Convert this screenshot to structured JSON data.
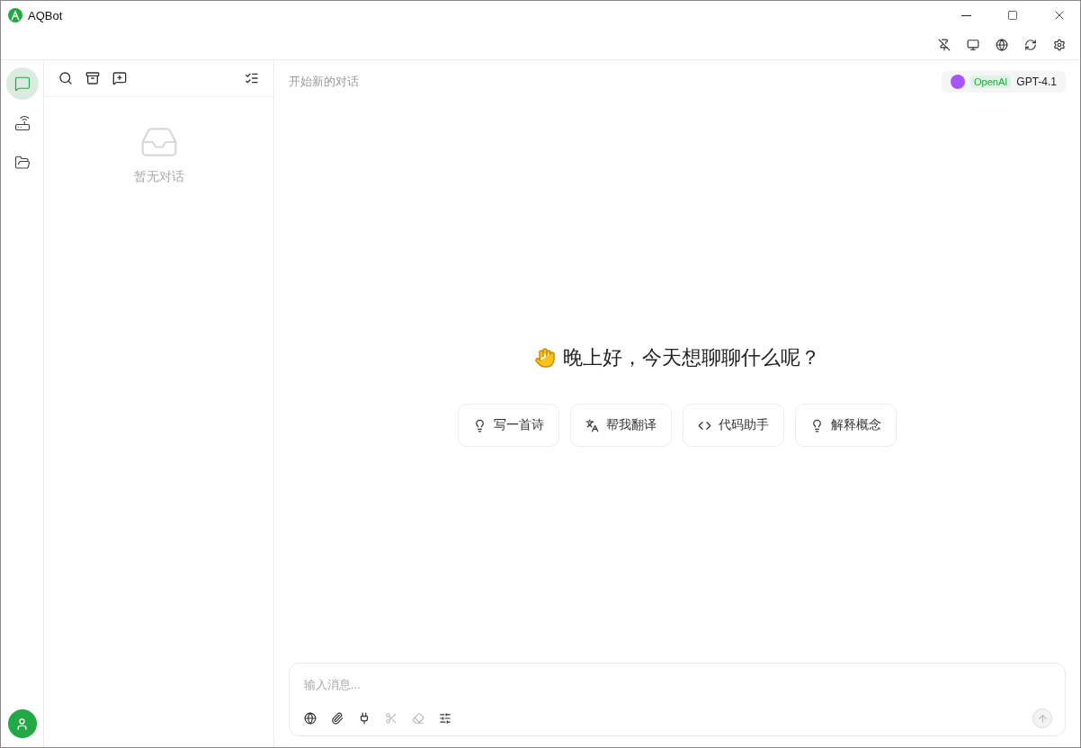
{
  "window": {
    "title": "AQBot"
  },
  "nav_items": [
    {
      "kind": "chat",
      "selected": true
    },
    {
      "kind": "gateway",
      "selected": false
    },
    {
      "kind": "files",
      "selected": false
    }
  ],
  "conversations": {
    "empty_text": "暂无对话"
  },
  "chat": {
    "title": "开始新的对话",
    "model": {
      "provider": "OpenAI",
      "name": "GPT-4.1"
    },
    "greeting": "晚上好，今天想聊聊什么呢？",
    "suggestions": [
      {
        "kind": "idea",
        "label": "写一首诗"
      },
      {
        "kind": "translate",
        "label": "帮我翻译"
      },
      {
        "kind": "code",
        "label": "代码助手"
      },
      {
        "kind": "idea",
        "label": "解释概念"
      }
    ],
    "input": {
      "placeholder": "输入消息...",
      "tools": [
        {
          "kind": "web",
          "disabled": false
        },
        {
          "kind": "attach",
          "disabled": false
        },
        {
          "kind": "plugin",
          "disabled": false
        },
        {
          "kind": "cut",
          "disabled": true
        },
        {
          "kind": "clear",
          "disabled": true
        },
        {
          "kind": "settings",
          "disabled": false
        }
      ],
      "send_disabled": true
    }
  }
}
